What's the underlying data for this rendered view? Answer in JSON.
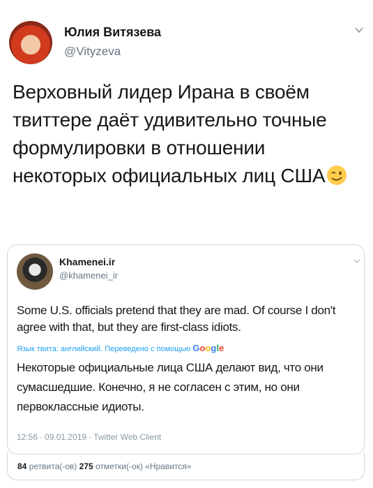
{
  "tweet": {
    "author_name": "Юлия Витязева",
    "author_handle": "@Vityzeva",
    "text": "Верховный лидер Ирана в своём твиттере даёт удивительно точные формулировки в отношении некоторых официальных лиц США",
    "emoji_icon": "winking-face-icon"
  },
  "quoted_tweet": {
    "author_name": "Khamenei.ir",
    "author_handle": "@khamenei_ir",
    "text": "Some U.S. officials pretend that they are mad. Of course I don't agree with that, but they are first-class idiots.",
    "translation_label": "Язык твита: английский. Переведено с помощью",
    "translation_provider": "Google",
    "translated_text": "Некоторые официальные лица США делают вид, что они сумасшедшие. Конечно, я не согласен с этим, но они первоклассные идиоты.",
    "time": "12:56",
    "date": "09.01.2019",
    "client": "Twitter Web Client"
  },
  "stats": {
    "retweets_count": "84",
    "retweets_label": "ретвита(-ов)",
    "likes_count": "275",
    "likes_label": "отметки(-ок) «Нравится»"
  },
  "colors": {
    "link": "#1da1f2",
    "secondary_text": "#657786",
    "border": "#ccd6dd"
  }
}
